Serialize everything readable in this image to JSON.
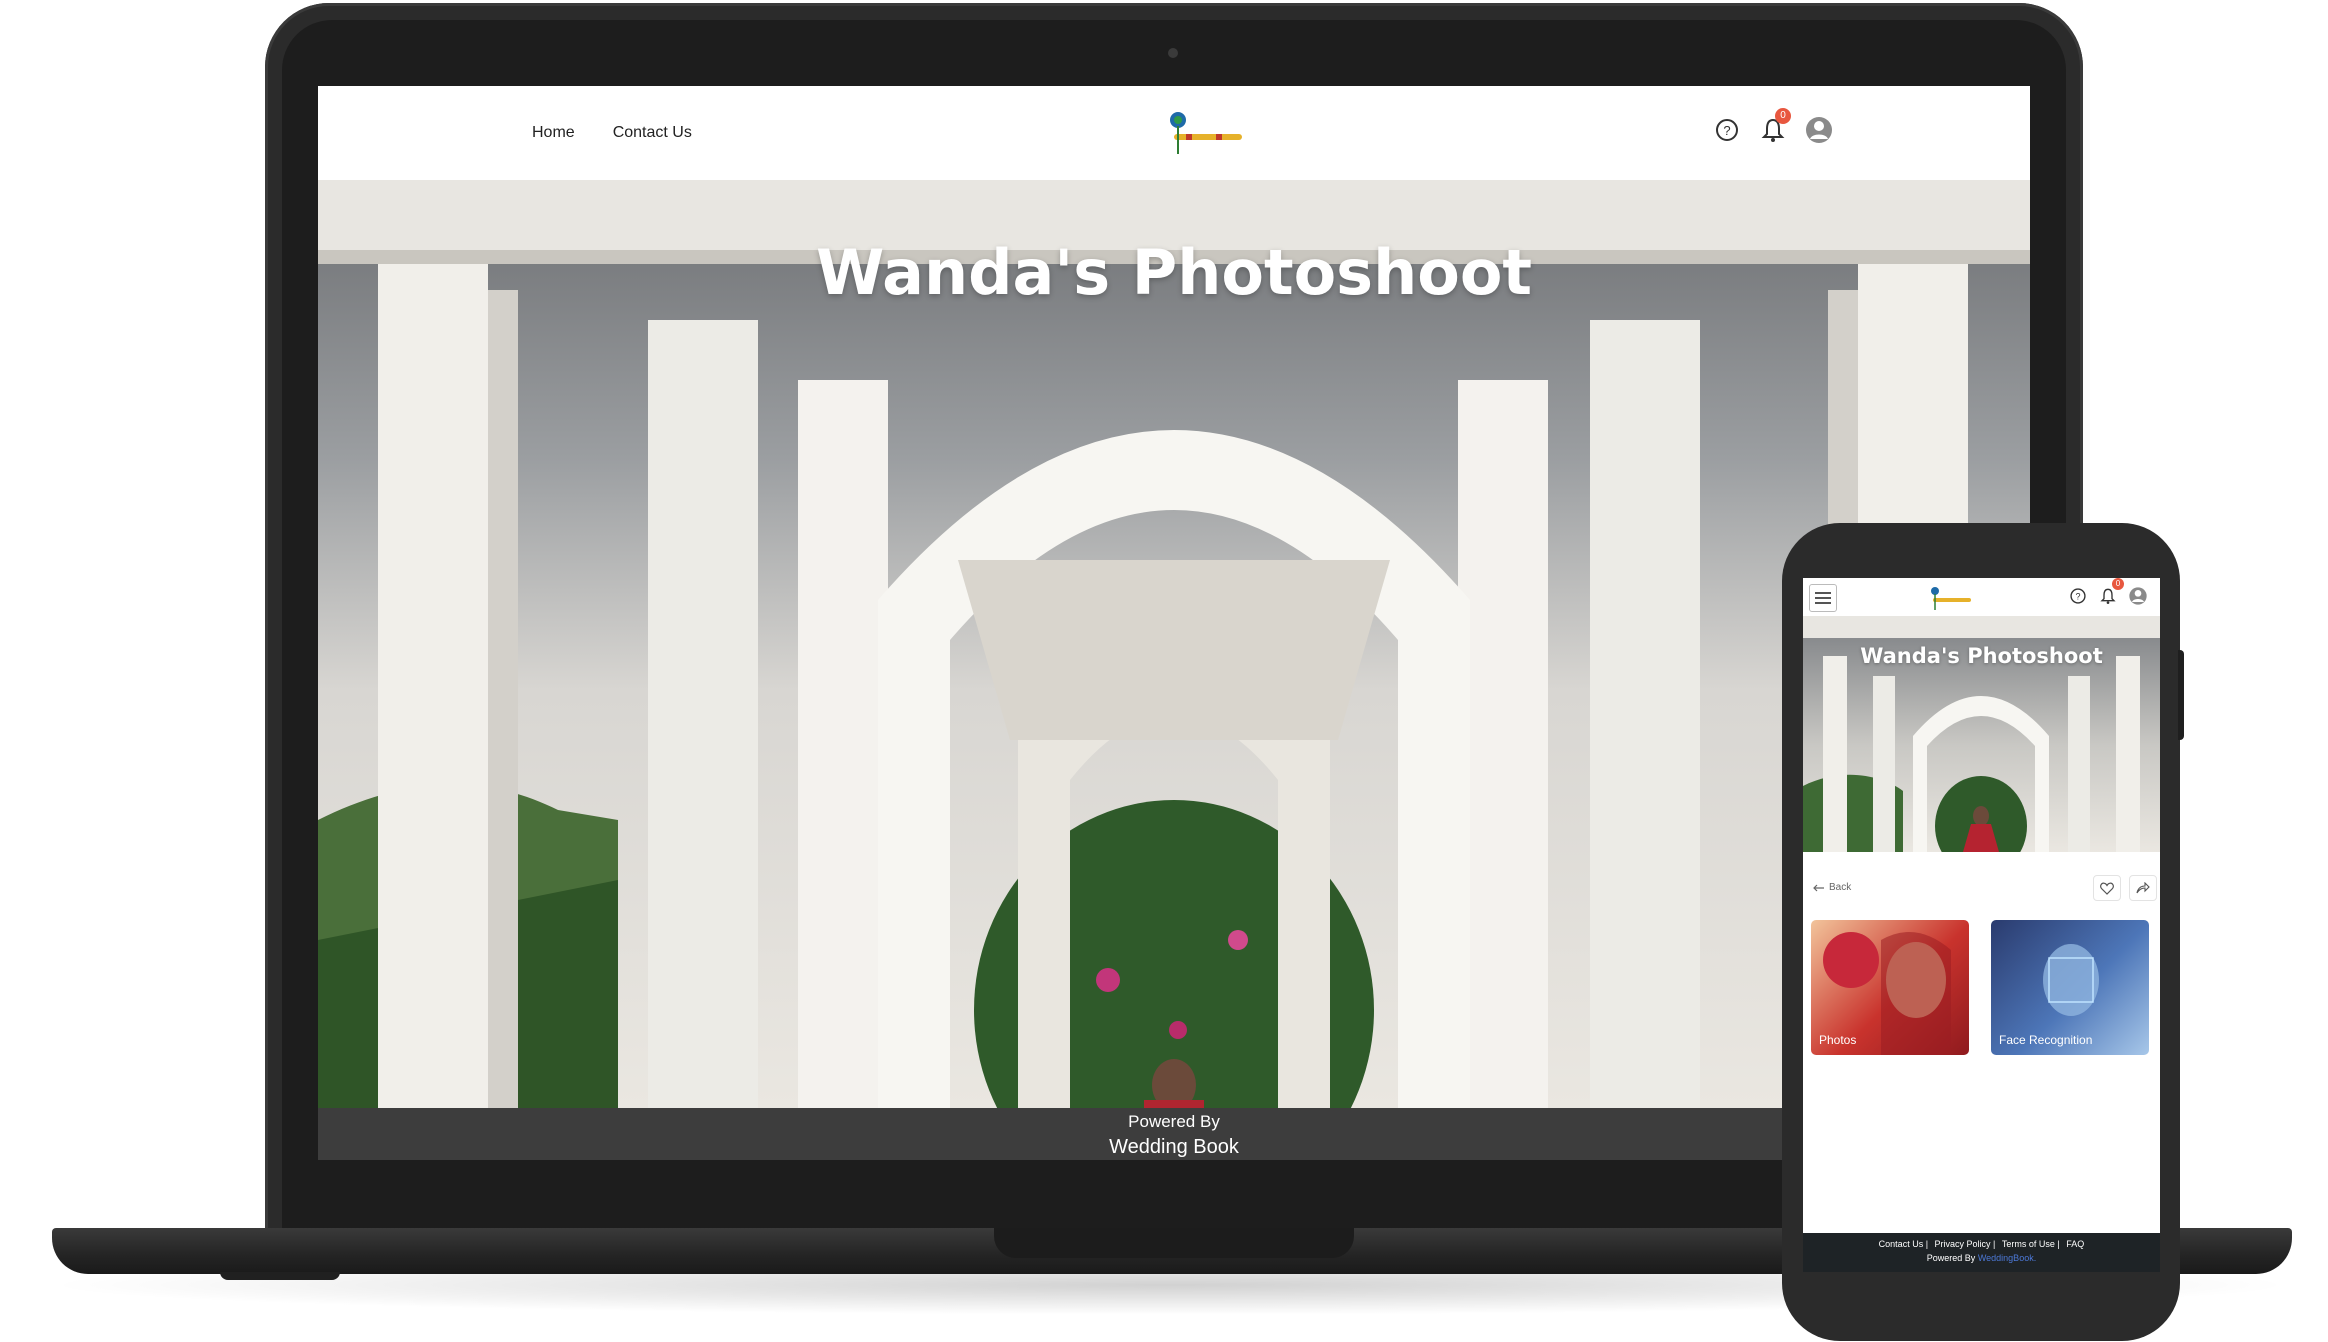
{
  "desktop": {
    "nav": [
      {
        "label": "Home"
      },
      {
        "label": "Contact Us"
      }
    ],
    "notification_count": "0",
    "hero_title": "Wanda's Photoshoot",
    "footer": {
      "powered_by": "Powered By",
      "brand": "Wedding Book"
    }
  },
  "mobile": {
    "notification_count": "0",
    "hero_title": "Wanda's Photoshoot",
    "back_label": "Back",
    "cards": [
      {
        "label": "Photos"
      },
      {
        "label": "Face Recognition"
      }
    ],
    "footer": {
      "links": [
        "Contact Us |",
        "Privacy Policy |",
        "Terms of Use |",
        "FAQ"
      ],
      "powered_by": "Powered By",
      "brand": "WeddingBook."
    }
  },
  "colors": {
    "badge": "#e8573f",
    "footer_dark": "#3d3d3d",
    "mobile_footer": "#1e2326",
    "brand_link": "#4c78d6"
  }
}
